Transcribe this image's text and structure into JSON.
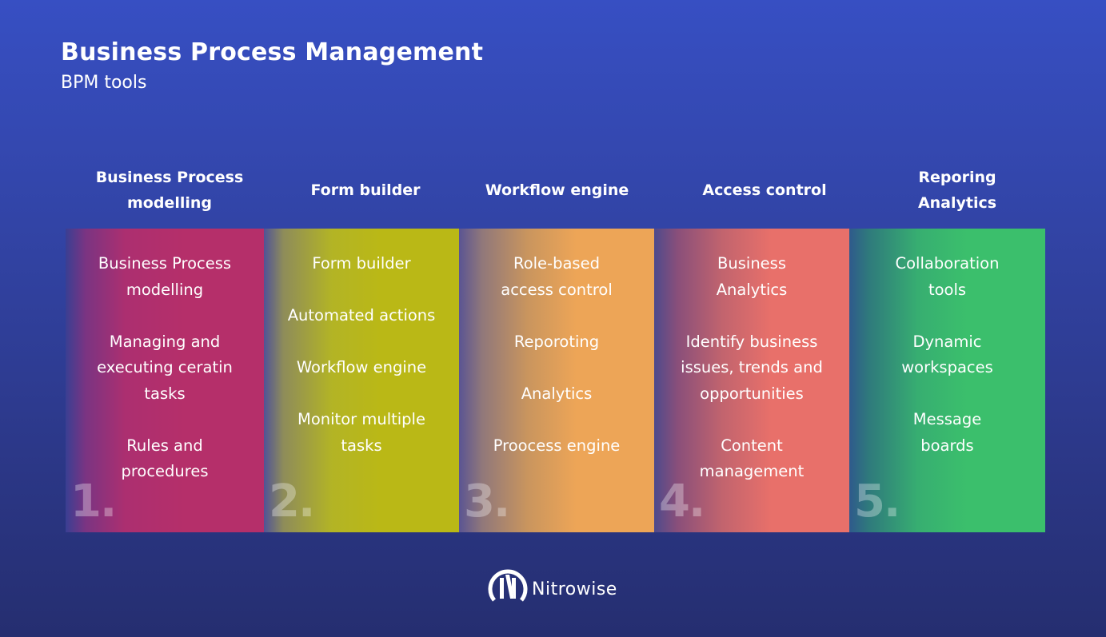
{
  "header": {
    "title": "Business Process Management",
    "subtitle": "BPM tools"
  },
  "columns": [
    {
      "number": "1.",
      "title": "Business Process modelling",
      "color": "#b52f6a",
      "items": [
        "Business Process modelling",
        "Managing and executing ceratin tasks",
        "Rules and procedures"
      ]
    },
    {
      "number": "2.",
      "title": "Form builder",
      "color": "#bab816",
      "items": [
        "Form builder",
        "Automated actions",
        "Workflow engine",
        "Monitor multiple tasks"
      ]
    },
    {
      "number": "3.",
      "title": "Workflow engine",
      "color": "#eda557",
      "items": [
        "Role-based access control",
        "Reporoting",
        "Analytics",
        "Proocess engine"
      ]
    },
    {
      "number": "4.",
      "title": "Access control",
      "color": "#e8706a",
      "items": [
        "Business Analytics",
        "Identify business issues, trends and opportunities",
        "Content management"
      ]
    },
    {
      "number": "5.",
      "title": "Reporing Analytics",
      "color": "#3bbf6c",
      "items": [
        "Collaboration tools",
        "Dynamic workspaces",
        "Message boards"
      ]
    }
  ],
  "footer": {
    "logo_icon": "nitrowise-logo-icon",
    "brand": "Nitrowise"
  }
}
